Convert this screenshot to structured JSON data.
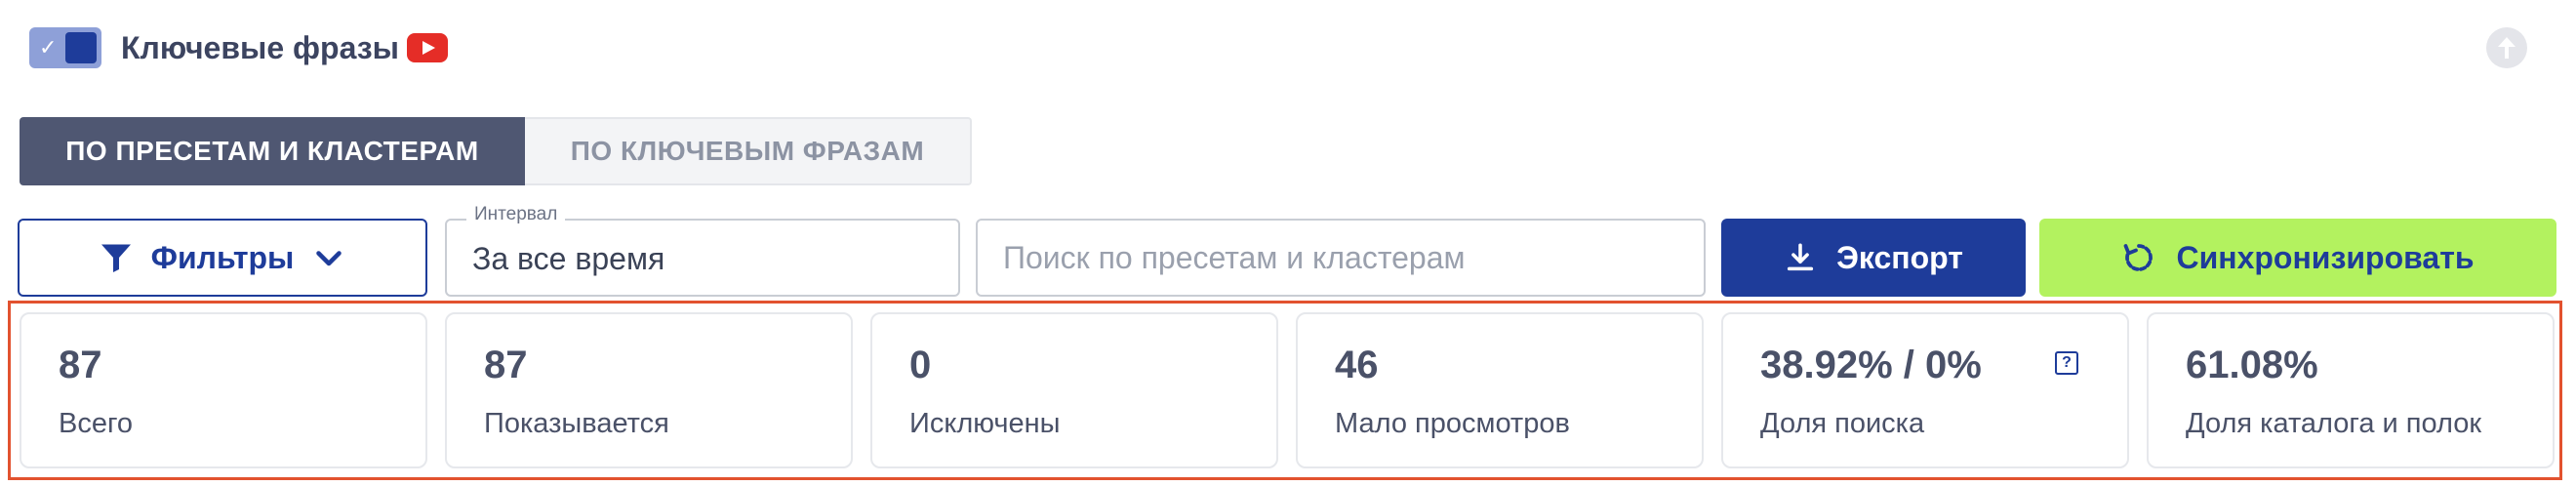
{
  "header": {
    "toggle_on": true,
    "title": "Ключевые фразы"
  },
  "tabs": [
    {
      "label": "ПО ПРЕСЕТАМ И КЛАСТЕРАМ",
      "active": true
    },
    {
      "label": "ПО КЛЮЧЕВЫМ ФРАЗАМ",
      "active": false
    }
  ],
  "toolbar": {
    "filters_label": "Фильтры",
    "interval_label": "Интервал",
    "interval_value": "За все время",
    "search_placeholder": "Поиск по пресетам и кластерам",
    "export_label": "Экспорт",
    "sync_label": "Синхронизировать"
  },
  "stats": [
    {
      "value": "87",
      "label": "Всего"
    },
    {
      "value": "87",
      "label": "Показывается"
    },
    {
      "value": "0",
      "label": "Исключены"
    },
    {
      "value": "46",
      "label": "Мало просмотров"
    },
    {
      "value": "38.92% / 0%",
      "label": "Доля поиска",
      "help": "?"
    },
    {
      "value": "61.08%",
      "label": "Доля каталога и полок"
    }
  ],
  "colors": {
    "primary": "#1e3c9a",
    "sync_bg": "#b3f25f",
    "tab_active_bg": "#4f5772",
    "highlight_frame": "#e2522f",
    "youtube_red": "#e52d27"
  },
  "icons": [
    "checkbox-toggle-icon",
    "youtube-icon",
    "scroll-up-icon",
    "funnel-icon",
    "chevron-down-icon",
    "download-icon",
    "sync-icon",
    "help-icon"
  ]
}
